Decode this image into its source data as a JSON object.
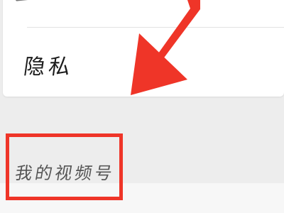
{
  "settings_list": {
    "items": [
      {
        "label": "隐私"
      }
    ]
  },
  "section": {
    "items": [
      {
        "label": "我的视频号"
      }
    ]
  },
  "annotation": {
    "color": "#ef3528",
    "highlight": "我的视频号"
  }
}
